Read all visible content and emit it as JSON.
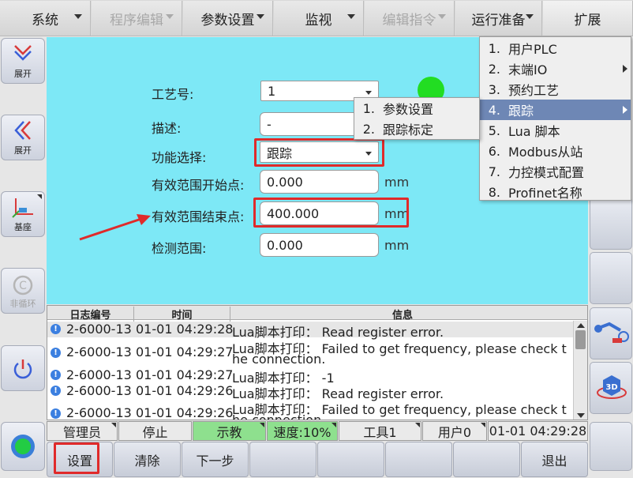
{
  "menu": {
    "items": [
      {
        "label": "系统",
        "disabled": false
      },
      {
        "label": "程序编辑",
        "disabled": true
      },
      {
        "label": "参数设置",
        "disabled": false
      },
      {
        "label": "监视",
        "disabled": false
      },
      {
        "label": "编辑指令",
        "disabled": true
      },
      {
        "label": "运行准备",
        "disabled": false
      },
      {
        "label": "扩展",
        "disabled": false
      }
    ]
  },
  "left_sidebar": {
    "expand1": "展开",
    "expand2": "展开",
    "base": "基座",
    "nontool": "非循环"
  },
  "form": {
    "process_label": "工艺号:",
    "process_value": "1",
    "desc_label": "描述:",
    "desc_value": "-",
    "function_label": "功能选择:",
    "function_value": "跟踪",
    "start_label": "有效范围开始点:",
    "start_value": "0.000",
    "end_label": "有效范围结束点:",
    "end_value": "400.000",
    "detect_label": "检测范围:",
    "detect_value": "0.000",
    "unit": "mm",
    "status_color": "#22dd22"
  },
  "extend_menu": {
    "items": [
      {
        "num": "1.",
        "label": "用户PLC",
        "submenu": false
      },
      {
        "num": "2.",
        "label": "末端IO",
        "submenu": true
      },
      {
        "num": "3.",
        "label": "预约工艺",
        "submenu": false
      },
      {
        "num": "4.",
        "label": "跟踪",
        "submenu": true
      },
      {
        "num": "5.",
        "label": "Lua 脚本",
        "submenu": false
      },
      {
        "num": "6.",
        "label": "Modbus从站",
        "submenu": false
      },
      {
        "num": "7.",
        "label": "力控模式配置",
        "submenu": false
      },
      {
        "num": "8.",
        "label": "Profinet名称",
        "submenu": false
      }
    ]
  },
  "track_submenu": {
    "items": [
      {
        "num": "1.",
        "label": "参数设置"
      },
      {
        "num": "2.",
        "label": "跟踪标定"
      }
    ]
  },
  "log": {
    "headers": [
      "日志编号",
      "时间",
      "信息"
    ],
    "rows": [
      {
        "id": "2-6000-13",
        "time": "01-01 04:29:28",
        "line1": "Lua脚本打印： Read register error.",
        "line2": ""
      },
      {
        "id": "2-6000-13",
        "time": "01-01 04:29:27",
        "line1": "Lua脚本打印： Failed to get frequency, please check t",
        "line2": "he connection."
      },
      {
        "id": "2-6000-13",
        "time": "01-01 04:29:27",
        "line1": "Lua脚本打印： -1",
        "line2": ""
      },
      {
        "id": "2-6000-13",
        "time": "01-01 04:29:26",
        "line1": "Lua脚本打印： Read register error.",
        "line2": ""
      },
      {
        "id": "2-6000-13",
        "time": "01-01 04:29:26",
        "line1": "Lua脚本打印： Failed to get frequency, please check t",
        "line2": "he connection."
      }
    ]
  },
  "status": {
    "user": "管理员",
    "run_state": "停止",
    "mode": "示教",
    "speed": "速度:10%",
    "tool": "工具1",
    "user_frame": "用户0",
    "clock": "01-01 04:29:28"
  },
  "bottom": {
    "settings": "设置",
    "clear": "清除",
    "next": "下一步",
    "exit": "退出"
  }
}
